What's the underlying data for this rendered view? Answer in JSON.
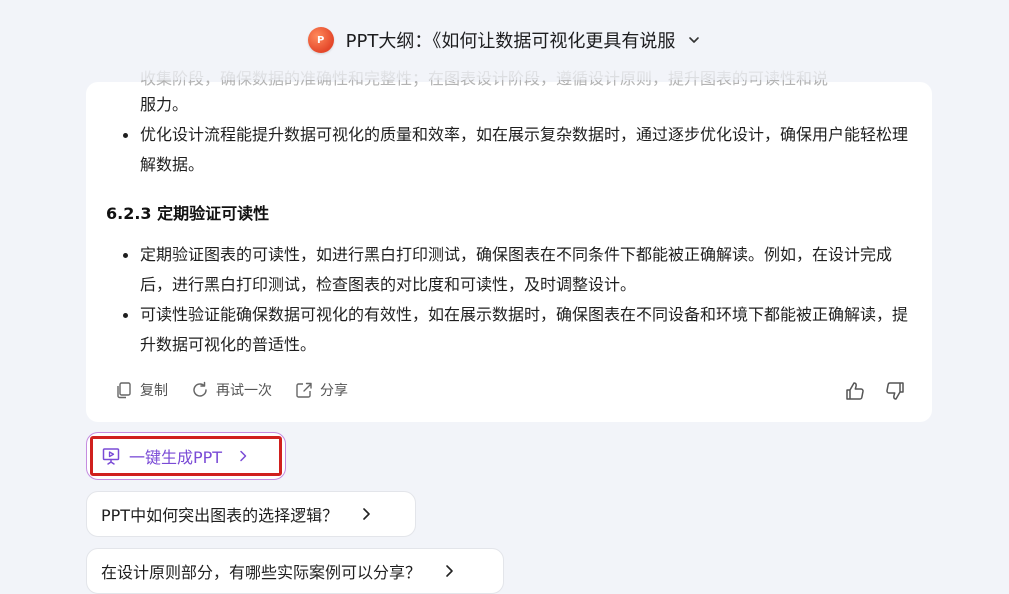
{
  "header": {
    "logo_text": "P",
    "title": "PPT大纲：《如何让数据可视化更具有说服"
  },
  "content": {
    "faded_line": "收集阶段，确保数据的准确性和完整性；在图表设计阶段，遵循设计原则，提升图表的可读性和说",
    "para_continuation": "服力。",
    "bullets_top": [
      "优化设计流程能提升数据可视化的质量和效率，如在展示复杂数据时，通过逐步优化设计，确保用户能轻松理解数据。"
    ],
    "section_heading": "6.2.3 定期验证可读性",
    "bullets_bottom": [
      "定期验证图表的可读性，如进行黑白打印测试，确保图表在不同条件下都能被正确解读。例如，在设计完成后，进行黑白打印测试，检查图表的对比度和可读性，及时调整设计。",
      "可读性验证能确保数据可视化的有效性，如在展示数据时，确保图表在不同设备和环境下都能被正确解读，提升数据可视化的普适性。"
    ]
  },
  "actions": {
    "copy_label": "复制",
    "retry_label": "再试一次",
    "share_label": "分享"
  },
  "generate": {
    "label": "一键生成PPT"
  },
  "suggestions": [
    "PPT中如何突出图表的选择逻辑？",
    "在设计原则部分，有哪些实际案例可以分享？"
  ],
  "colors": {
    "accent_purple": "#7a4bd6",
    "highlight_red": "#d0201e",
    "background": "#f2f4f9"
  }
}
